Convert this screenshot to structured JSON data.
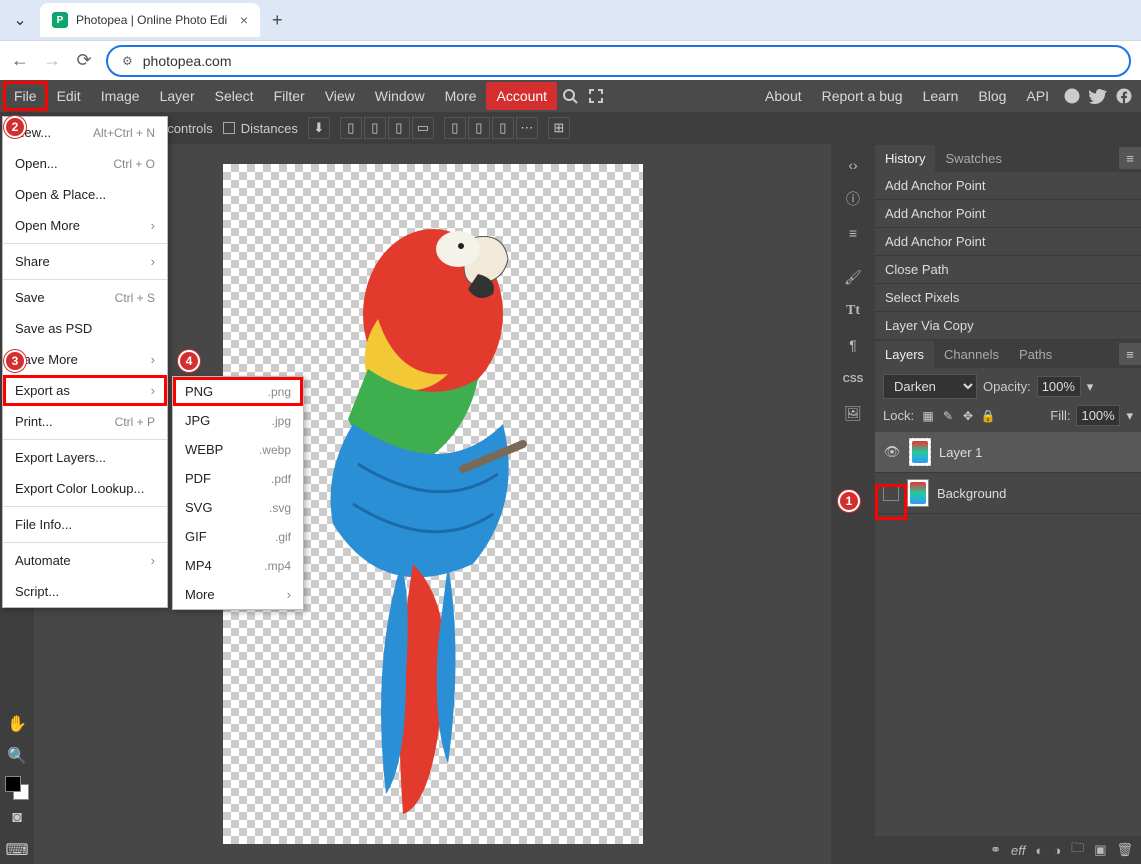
{
  "browser": {
    "tab_title": "Photopea | Online Photo Edi",
    "url": "photopea.com"
  },
  "menubar": {
    "items": [
      "File",
      "Edit",
      "Image",
      "Layer",
      "Select",
      "Filter",
      "View",
      "Window",
      "More"
    ],
    "account": "Account",
    "right_links": [
      "About",
      "Report a bug",
      "Learn",
      "Blog",
      "API"
    ]
  },
  "optionsbar": {
    "transform_controls": "Transform controls",
    "distances": "Distances"
  },
  "file_menu": {
    "items": [
      {
        "label": "New...",
        "shortcut": "Alt+Ctrl + N"
      },
      {
        "label": "Open...",
        "shortcut": "Ctrl + O"
      },
      {
        "label": "Open & Place...",
        "shortcut": ""
      },
      {
        "label": "Open More",
        "sub": true
      },
      {
        "sep": true
      },
      {
        "label": "Share",
        "sub": true
      },
      {
        "sep": true
      },
      {
        "label": "Save",
        "shortcut": "Ctrl + S"
      },
      {
        "label": "Save as PSD",
        "shortcut": ""
      },
      {
        "label": "Save More",
        "sub": true
      },
      {
        "label": "Export as",
        "sub": true,
        "highlight": true
      },
      {
        "label": "Print...",
        "shortcut": "Ctrl + P"
      },
      {
        "sep": true
      },
      {
        "label": "Export Layers...",
        "shortcut": ""
      },
      {
        "label": "Export Color Lookup...",
        "shortcut": ""
      },
      {
        "sep": true
      },
      {
        "label": "File Info...",
        "shortcut": ""
      },
      {
        "sep": true
      },
      {
        "label": "Automate",
        "sub": true
      },
      {
        "label": "Script...",
        "shortcut": ""
      }
    ]
  },
  "export_submenu": {
    "items": [
      {
        "label": "PNG",
        "ext": ".png",
        "highlight": true
      },
      {
        "label": "JPG",
        "ext": ".jpg"
      },
      {
        "label": "WEBP",
        "ext": ".webp"
      },
      {
        "label": "PDF",
        "ext": ".pdf"
      },
      {
        "label": "SVG",
        "ext": ".svg"
      },
      {
        "label": "GIF",
        "ext": ".gif"
      },
      {
        "label": "MP4",
        "ext": ".mp4"
      },
      {
        "label": "More",
        "sub": true
      }
    ]
  },
  "history_panel": {
    "tabs": [
      "History",
      "Swatches"
    ],
    "items": [
      "Add Anchor Point",
      "Add Anchor Point",
      "Add Anchor Point",
      "Close Path",
      "Select Pixels",
      "Layer Via Copy"
    ]
  },
  "layers_panel": {
    "tabs": [
      "Layers",
      "Channels",
      "Paths"
    ],
    "blend_mode": "Darken",
    "opacity_label": "Opacity:",
    "opacity_value": "100%",
    "lock_label": "Lock:",
    "fill_label": "Fill:",
    "fill_value": "100%",
    "rows": [
      {
        "name": "Layer 1",
        "visible": true,
        "active": true
      },
      {
        "name": "Background",
        "visible": false,
        "active": false,
        "annot": true
      }
    ]
  },
  "right_icon_strip": [
    "‹›",
    "ⓘ",
    "≡",
    "brush",
    "Tt",
    "¶",
    "css",
    "img"
  ],
  "annotations": {
    "b1": "1",
    "b2": "2",
    "b3": "3",
    "b4": "4"
  }
}
